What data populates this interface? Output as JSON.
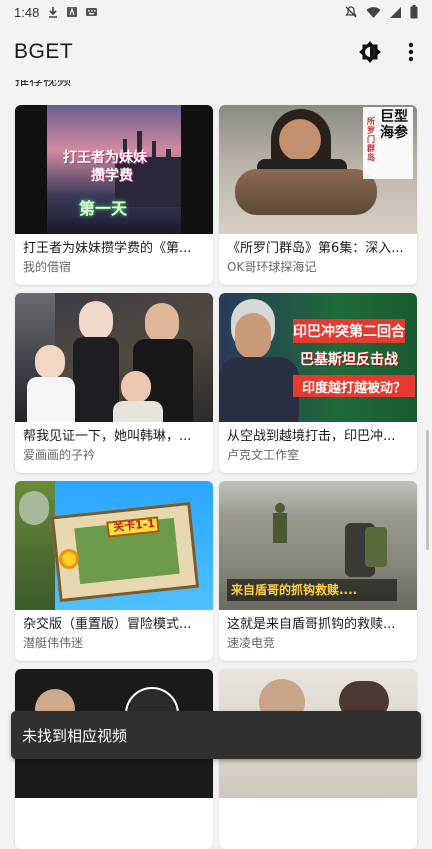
{
  "status": {
    "time": "1:48"
  },
  "app": {
    "title": "BGET"
  },
  "section": {
    "title": "推荐视频"
  },
  "videos": [
    {
      "title": "打王者为妹妹攒学费的《第...",
      "author": "我的借宿",
      "overlay": [
        "打王者为妹妹",
        "攒学费",
        "第一天"
      ]
    },
    {
      "title": "《所罗门群岛》第6集：深入...",
      "author": "OK哥环球探海记",
      "overlay": [
        "巨型海参",
        "所罗门群岛"
      ]
    },
    {
      "title": "帮我见证一下，她叫韩琳，...",
      "author": "爱画画的子衿",
      "overlay": []
    },
    {
      "title": "从空战到越境打击，印巴冲...",
      "author": "卢克文工作室",
      "overlay": [
        "印巴冲突第二回合",
        "巴基斯坦反击战",
        "印度越打越被动？"
      ]
    },
    {
      "title": "杂交版（重置版）冒险模式...",
      "author": "潜艇伟伟迷",
      "overlay": [
        "关卡1-1"
      ]
    },
    {
      "title": "这就是来自盾哥抓钩的救赎...",
      "author": "速凌电竞",
      "overlay": [
        "来自盾哥的抓钩救赎...."
      ]
    },
    {
      "title": "",
      "author": "",
      "overlay": []
    },
    {
      "title": "",
      "author": "",
      "overlay": []
    }
  ],
  "snackbar": {
    "message": "未找到相应视频"
  },
  "colors": {
    "background": "#f3f3f3",
    "card": "#ffffff",
    "snackbar": "#303030"
  }
}
